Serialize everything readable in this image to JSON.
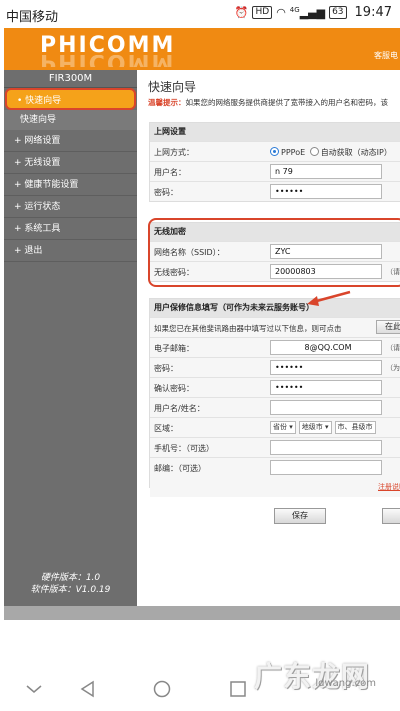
{
  "statusbar": {
    "carrier": "中国移动",
    "hd": "HD",
    "signal_gen": "4G",
    "battery": "63",
    "time": "19:47"
  },
  "banner": {
    "logo": "PHICOMM",
    "home_link": "客服电"
  },
  "sidebar": {
    "model": "FIR300M",
    "items": [
      {
        "label": "• 快速向导"
      },
      {
        "label": "快速向导"
      },
      {
        "label": "+ 网络设置"
      },
      {
        "label": "+ 无线设置"
      },
      {
        "label": "+ 健康节能设置"
      },
      {
        "label": "+ 运行状态"
      },
      {
        "label": "+ 系统工具"
      },
      {
        "label": "+ 退出"
      }
    ],
    "hw_version": "硬件版本：1.0",
    "sw_version": "软件版本：V1.0.19"
  },
  "main": {
    "title": "快速向导",
    "tip_label": "温馨提示：",
    "tip_text": "如果您的网络服务提供商提供了宽带接入的用户名和密码，该",
    "wan": {
      "head": "上网设置",
      "type_label": "上网方式：",
      "opt1": "PPPoE",
      "opt2": "自动获取（动态IP）",
      "user_label": "用户名：",
      "user_value": "n            79",
      "pwd_label": "密码：",
      "pwd_value": "••••••"
    },
    "wifi": {
      "head": "无线加密",
      "ssid_label": "网络名称（SSID）：",
      "ssid_value": "ZYC",
      "key_label": "无线密码：",
      "key_value": "20000803",
      "key_suffix": "（请"
    },
    "account": {
      "head": "用户保修信息填写（可作为未来云服务账号）",
      "notice": "如果您已在其他斐讯路由器中填写过以下信息，则可点击",
      "notice_btn": "在此",
      "email_label": "电子邮箱：",
      "email_value": "8@QQ.COM",
      "email_suffix": "（请",
      "pwd_label": "密码：",
      "pwd_value": "••••••",
      "pwd_suffix": "（为",
      "pwd2_label": "确认密码：",
      "pwd2_value": "••••••",
      "name_label": "用户名/姓名：",
      "name_value": "",
      "region_label": "区域：",
      "prov": "省份",
      "city": "地级市",
      "county": "市、县级市",
      "phone_label": "手机号：（可选）",
      "phone_value": "",
      "mail_label": "邮编：（可选）",
      "mail_value": "",
      "reg_link": "注册说明"
    },
    "save": "保存"
  },
  "watermark": {
    "big": "广东龙网",
    "small": "ldwang.com"
  }
}
